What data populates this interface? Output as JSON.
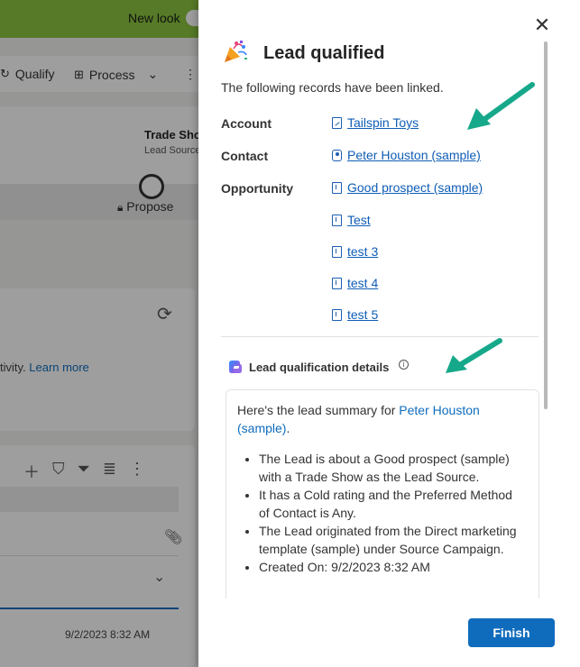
{
  "background_app": {
    "toggle_label": "New look",
    "commands": [
      "Qualify",
      "Process"
    ],
    "header_field": "Trade Sho",
    "header_subfield": "Lead Source",
    "stage": "Propose",
    "activity_text": "tivity.",
    "learn_more": "Learn more",
    "row_date": "9/2/2023 8:32 AM"
  },
  "dialog": {
    "title": "Lead qualified",
    "subtitle": "The following records have been linked.",
    "account_label": "Account",
    "contact_label": "Contact",
    "opportunity_label": "Opportunity",
    "account_link": "Tailspin Toys",
    "contact_link": "Peter Houston (sample)",
    "opportunities": [
      "Good prospect (sample)",
      "Test",
      "test 3",
      "test 4",
      "test 5"
    ],
    "details_heading": "Lead qualification details",
    "summary_intro": "Here's the lead summary for ",
    "summary_name": "Peter Houston (sample)",
    "summary_end": ".",
    "bullets": [
      "The Lead is about a Good prospect (sample) with a Trade Show as the Lead Source.",
      "It has a Cold rating and the Preferred Method of Contact is Any.",
      "The Lead originated from the Direct marketing template (sample) under Source Campaign.",
      "Created On: 9/2/2023 8:32 AM"
    ],
    "finish_label": "Finish"
  },
  "colors": {
    "accent": "#0f6cbd",
    "link": "#0f5db6",
    "annotation_arrow": "#16a88a",
    "topbar": "#8bc53f"
  }
}
